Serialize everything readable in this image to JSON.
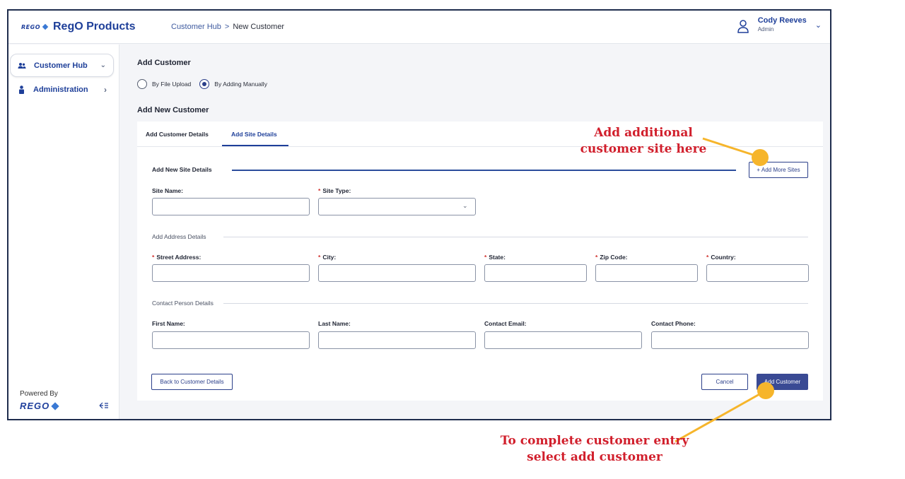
{
  "header": {
    "brand_mark": "REGO",
    "brand_title": "RegO Products",
    "breadcrumb": [
      "Customer Hub",
      "New Customer"
    ],
    "breadcrumb_sep": ">",
    "user": {
      "name": "Cody Reeves",
      "role": "Admin"
    }
  },
  "sidebar": {
    "items": [
      {
        "label": "Customer Hub",
        "icon": "users-icon",
        "active": true,
        "chevron": "down"
      },
      {
        "label": "Administration",
        "icon": "person-icon",
        "active": false,
        "chevron": "right"
      }
    ],
    "powered_by": "Powered By",
    "powered_logo": "REGO"
  },
  "main": {
    "add_customer_heading": "Add Customer",
    "radio_options": [
      {
        "label": "By File Upload",
        "selected": false
      },
      {
        "label": "By Adding Manually",
        "selected": true
      }
    ],
    "add_new_customer_heading": "Add New Customer",
    "tabs": [
      {
        "label": "Add Customer Details",
        "active": false
      },
      {
        "label": "Add Site Details",
        "active": true
      }
    ],
    "site_section_title": "Add New Site Details",
    "add_more_sites_label": "+ Add More Sites",
    "fields": {
      "site_name": {
        "label": "Site Name:",
        "value": ""
      },
      "site_type": {
        "label": "Site Type:",
        "value": "",
        "required": true
      },
      "street_address": {
        "label": "Street Address:",
        "value": "",
        "required": true
      },
      "city": {
        "label": "City:",
        "value": "",
        "required": true
      },
      "state": {
        "label": "State:",
        "value": "",
        "required": true
      },
      "zip_code": {
        "label": "Zip Code:",
        "value": "",
        "required": true
      },
      "country": {
        "label": "Country:",
        "value": "",
        "required": true
      },
      "first_name": {
        "label": "First Name:",
        "value": ""
      },
      "last_name": {
        "label": "Last Name:",
        "value": ""
      },
      "contact_email": {
        "label": "Contact Email:",
        "value": ""
      },
      "contact_phone": {
        "label": "Contact Phone:",
        "value": ""
      }
    },
    "address_section_title": "Add Address Details",
    "contact_section_title": "Contact Person Details",
    "required_mark": "*",
    "buttons": {
      "back": "Back to Customer Details",
      "cancel": "Cancel",
      "add_customer": "Add Customer"
    }
  },
  "annotations": {
    "add_sites_note": "Add additional customer site here",
    "add_customer_note": "To complete customer entry select add customer",
    "callout_color": "#f6b52b",
    "text_color": "#d11f2c"
  }
}
